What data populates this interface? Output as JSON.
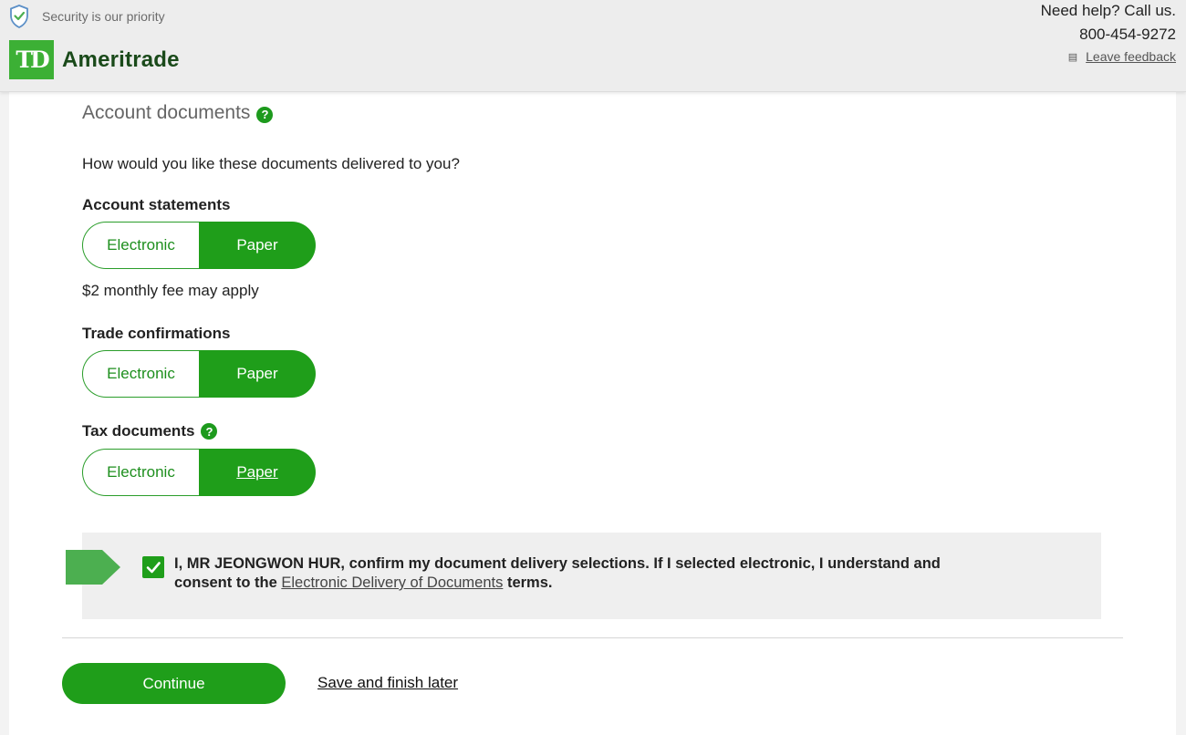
{
  "header": {
    "security_text": "Security is our priority",
    "logo_mark": "TD",
    "brand_name": "Ameritrade",
    "help_text": "Need help? Call us.",
    "phone": "800-454-9272",
    "feedback_label": "Leave feedback",
    "feedback_icon": "feedback-icon"
  },
  "main": {
    "section_title": "Account documents",
    "question": "How would you like these documents delivered to you?",
    "groups": [
      {
        "label": "Account statements",
        "options": [
          "Electronic",
          "Paper"
        ],
        "selected": "Paper",
        "note": "$2 monthly fee may apply"
      },
      {
        "label": "Trade confirmations",
        "options": [
          "Electronic",
          "Paper"
        ],
        "selected": "Paper"
      },
      {
        "label": "Tax documents",
        "options": [
          "Electronic",
          "Paper"
        ],
        "selected": "Paper",
        "has_help": true
      }
    ],
    "confirm": {
      "checked": true,
      "text_before": "I, MR JEONGWON HUR, confirm my document delivery selections. If I selected electronic, I understand and consent to the ",
      "link": "Electronic Delivery of Documents",
      "text_after": " terms."
    },
    "continue_label": "Continue",
    "save_later_label": "Save and finish later"
  },
  "colors": {
    "accent": "#1f9e1a",
    "logo": "#3cb035",
    "arrow": "#4caf50"
  }
}
